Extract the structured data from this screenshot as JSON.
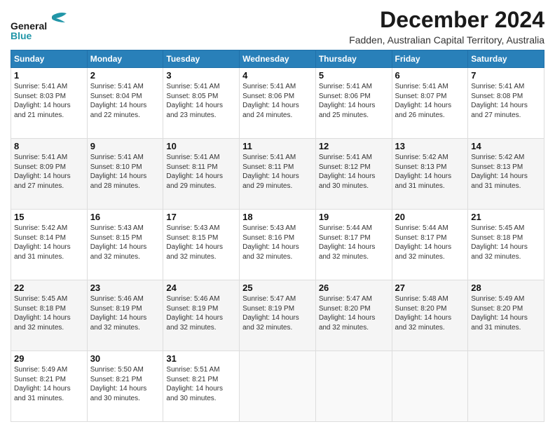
{
  "logo": {
    "line1": "General",
    "line2": "Blue"
  },
  "title": "December 2024",
  "subtitle": "Fadden, Australian Capital Territory, Australia",
  "days_header": [
    "Sunday",
    "Monday",
    "Tuesday",
    "Wednesday",
    "Thursday",
    "Friday",
    "Saturday"
  ],
  "weeks": [
    [
      {
        "num": "1",
        "sunrise": "5:41 AM",
        "sunset": "8:03 PM",
        "daylight": "14 hours and 21 minutes."
      },
      {
        "num": "2",
        "sunrise": "5:41 AM",
        "sunset": "8:04 PM",
        "daylight": "14 hours and 22 minutes."
      },
      {
        "num": "3",
        "sunrise": "5:41 AM",
        "sunset": "8:05 PM",
        "daylight": "14 hours and 23 minutes."
      },
      {
        "num": "4",
        "sunrise": "5:41 AM",
        "sunset": "8:06 PM",
        "daylight": "14 hours and 24 minutes."
      },
      {
        "num": "5",
        "sunrise": "5:41 AM",
        "sunset": "8:06 PM",
        "daylight": "14 hours and 25 minutes."
      },
      {
        "num": "6",
        "sunrise": "5:41 AM",
        "sunset": "8:07 PM",
        "daylight": "14 hours and 26 minutes."
      },
      {
        "num": "7",
        "sunrise": "5:41 AM",
        "sunset": "8:08 PM",
        "daylight": "14 hours and 27 minutes."
      }
    ],
    [
      {
        "num": "8",
        "sunrise": "5:41 AM",
        "sunset": "8:09 PM",
        "daylight": "14 hours and 27 minutes."
      },
      {
        "num": "9",
        "sunrise": "5:41 AM",
        "sunset": "8:10 PM",
        "daylight": "14 hours and 28 minutes."
      },
      {
        "num": "10",
        "sunrise": "5:41 AM",
        "sunset": "8:11 PM",
        "daylight": "14 hours and 29 minutes."
      },
      {
        "num": "11",
        "sunrise": "5:41 AM",
        "sunset": "8:11 PM",
        "daylight": "14 hours and 29 minutes."
      },
      {
        "num": "12",
        "sunrise": "5:41 AM",
        "sunset": "8:12 PM",
        "daylight": "14 hours and 30 minutes."
      },
      {
        "num": "13",
        "sunrise": "5:42 AM",
        "sunset": "8:13 PM",
        "daylight": "14 hours and 31 minutes."
      },
      {
        "num": "14",
        "sunrise": "5:42 AM",
        "sunset": "8:13 PM",
        "daylight": "14 hours and 31 minutes."
      }
    ],
    [
      {
        "num": "15",
        "sunrise": "5:42 AM",
        "sunset": "8:14 PM",
        "daylight": "14 hours and 31 minutes."
      },
      {
        "num": "16",
        "sunrise": "5:43 AM",
        "sunset": "8:15 PM",
        "daylight": "14 hours and 32 minutes."
      },
      {
        "num": "17",
        "sunrise": "5:43 AM",
        "sunset": "8:15 PM",
        "daylight": "14 hours and 32 minutes."
      },
      {
        "num": "18",
        "sunrise": "5:43 AM",
        "sunset": "8:16 PM",
        "daylight": "14 hours and 32 minutes."
      },
      {
        "num": "19",
        "sunrise": "5:44 AM",
        "sunset": "8:17 PM",
        "daylight": "14 hours and 32 minutes."
      },
      {
        "num": "20",
        "sunrise": "5:44 AM",
        "sunset": "8:17 PM",
        "daylight": "14 hours and 32 minutes."
      },
      {
        "num": "21",
        "sunrise": "5:45 AM",
        "sunset": "8:18 PM",
        "daylight": "14 hours and 32 minutes."
      }
    ],
    [
      {
        "num": "22",
        "sunrise": "5:45 AM",
        "sunset": "8:18 PM",
        "daylight": "14 hours and 32 minutes."
      },
      {
        "num": "23",
        "sunrise": "5:46 AM",
        "sunset": "8:19 PM",
        "daylight": "14 hours and 32 minutes."
      },
      {
        "num": "24",
        "sunrise": "5:46 AM",
        "sunset": "8:19 PM",
        "daylight": "14 hours and 32 minutes."
      },
      {
        "num": "25",
        "sunrise": "5:47 AM",
        "sunset": "8:19 PM",
        "daylight": "14 hours and 32 minutes."
      },
      {
        "num": "26",
        "sunrise": "5:47 AM",
        "sunset": "8:20 PM",
        "daylight": "14 hours and 32 minutes."
      },
      {
        "num": "27",
        "sunrise": "5:48 AM",
        "sunset": "8:20 PM",
        "daylight": "14 hours and 32 minutes."
      },
      {
        "num": "28",
        "sunrise": "5:49 AM",
        "sunset": "8:20 PM",
        "daylight": "14 hours and 31 minutes."
      }
    ],
    [
      {
        "num": "29",
        "sunrise": "5:49 AM",
        "sunset": "8:21 PM",
        "daylight": "14 hours and 31 minutes."
      },
      {
        "num": "30",
        "sunrise": "5:50 AM",
        "sunset": "8:21 PM",
        "daylight": "14 hours and 30 minutes."
      },
      {
        "num": "31",
        "sunrise": "5:51 AM",
        "sunset": "8:21 PM",
        "daylight": "14 hours and 30 minutes."
      },
      null,
      null,
      null,
      null
    ]
  ]
}
